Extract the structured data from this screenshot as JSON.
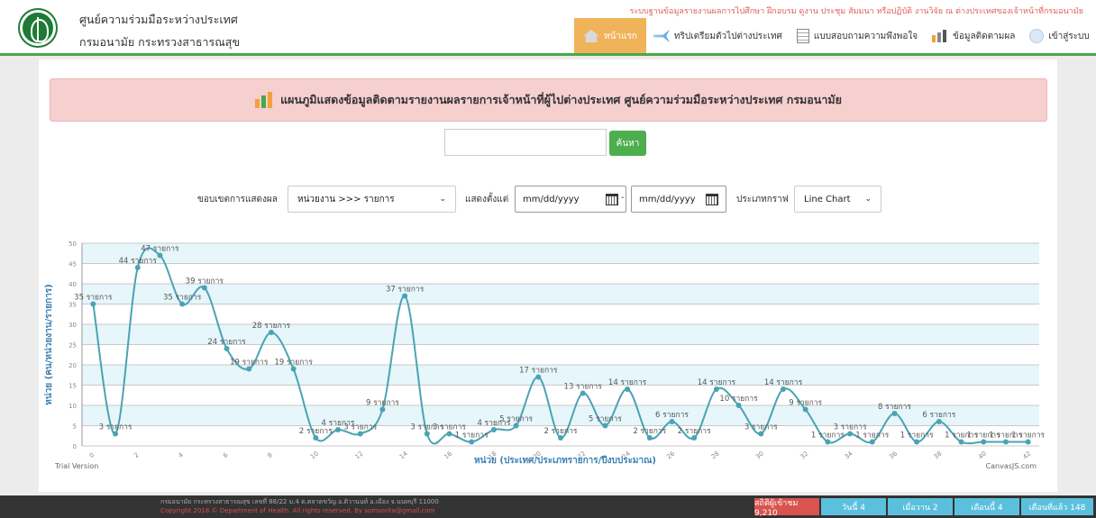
{
  "header": {
    "org_name": "ศูนย์ความร่วมมือระหว่างประเทศ",
    "department": "กรมอนามัย กระทรวงสาธารณสุข",
    "top_notice": "ระบบฐานข้อมูลรายงานผลการไปศึกษา ฝึกอบรม ดูงาน ประชุม สัมมนา หรือปฏิบัติ งานวิจัย ณ ต่างประเทศของเจ้าหน้าที่กรมอนามัย"
  },
  "nav": {
    "home": "หน้าแรก",
    "trip_prep": "ทริปเตรียมตัวไปต่างประเทศ",
    "survey": "แบบสอบถามความพึงพอใจ",
    "tracking": "ข้อมูลติดตามผล",
    "login": "เข้าสู่ระบบ"
  },
  "banner": {
    "title": "แผนภูมิแสดงข้อมูลติดตามรายงานผลรายการเจ้าหน้าที่ผู้ไปต่างประเทศ ศูนย์ความร่วมมือระหว่างประเทศ กรมอนามัย"
  },
  "search": {
    "placeholder": "",
    "button": "ค้นหา"
  },
  "filters": {
    "scope_label": "ขอบเขตการแสดงผล",
    "scope_value": "หน่วยงาน >>> รายการ",
    "from_label": "แสดงตั้งแต่",
    "date_from": "mm/dd/yyyy",
    "dash": "-",
    "date_to": "mm/dd/yyyy",
    "graph_type_label": "ประเภทกราฟ",
    "graph_type_value": "Line Chart"
  },
  "chart_data": {
    "type": "line",
    "title": "",
    "xlabel": "หน่วย (ประเทศ/ประเภทรายการ/ปีงบประมาณ)",
    "ylabel": "หน่วย (คน/หน่วยงาน/รายการ)",
    "ylim": [
      0,
      50
    ],
    "yticks": [
      0,
      5,
      10,
      15,
      20,
      25,
      30,
      35,
      40,
      45,
      50
    ],
    "xticks": [
      0,
      2,
      4,
      6,
      8,
      10,
      12,
      14,
      16,
      18,
      20,
      22,
      24,
      26,
      28,
      30,
      32,
      34,
      36,
      38,
      40,
      42
    ],
    "xlim": [
      -0.5,
      42.5
    ],
    "curve": "spline",
    "grid": true,
    "point_label_suffix": " รายการ",
    "x": [
      0,
      1,
      2,
      3,
      4,
      5,
      6,
      7,
      8,
      9,
      10,
      11,
      12,
      13,
      14,
      15,
      16,
      17,
      18,
      19,
      20,
      21,
      22,
      23,
      24,
      25,
      26,
      27,
      28,
      29,
      30,
      31,
      32,
      33,
      34,
      35,
      36,
      37,
      38,
      39,
      40,
      41,
      42
    ],
    "values": [
      35,
      3,
      44,
      47,
      35,
      39,
      24,
      19,
      28,
      19,
      2,
      4,
      3,
      9,
      37,
      3,
      3,
      1,
      4,
      5,
      17,
      2,
      13,
      5,
      14,
      2,
      6,
      2,
      14,
      10,
      3,
      14,
      9,
      1,
      3,
      1,
      8,
      1,
      6,
      1,
      1,
      1,
      1
    ],
    "line_color": "#4aa3b4",
    "band_color": "#e6f6fb",
    "trial_text": "Trial Version",
    "credit_text": "CanvasJS.com"
  },
  "footer": {
    "address": "กรมอนามัย กระทรวงสาธารณสุข เลขที่ 88/22 ม.4 ต.ตลาดขวัญ อ.ติวานนท์ อ.เมือง จ.นนทบุรี 11000",
    "copyright": "Copyright 2018 © Department of Health. All rights reserved. By somsorita@gmail.com",
    "stats": {
      "total": "สถิติผู้เข้าชม  9,210",
      "today": "วันนี้  4",
      "yesterday": "เมื่อวาน  2",
      "this_month": "เดือนนี้  4",
      "last_month": "เดือนที่แล้ว  148"
    }
  },
  "colors": {
    "accent_green": "#4aa84a",
    "nav_active": "#f0b35a",
    "banner_bg": "#f6cfcf",
    "stat_red": "#d9534f",
    "stat_blue": "#5bc0de"
  }
}
